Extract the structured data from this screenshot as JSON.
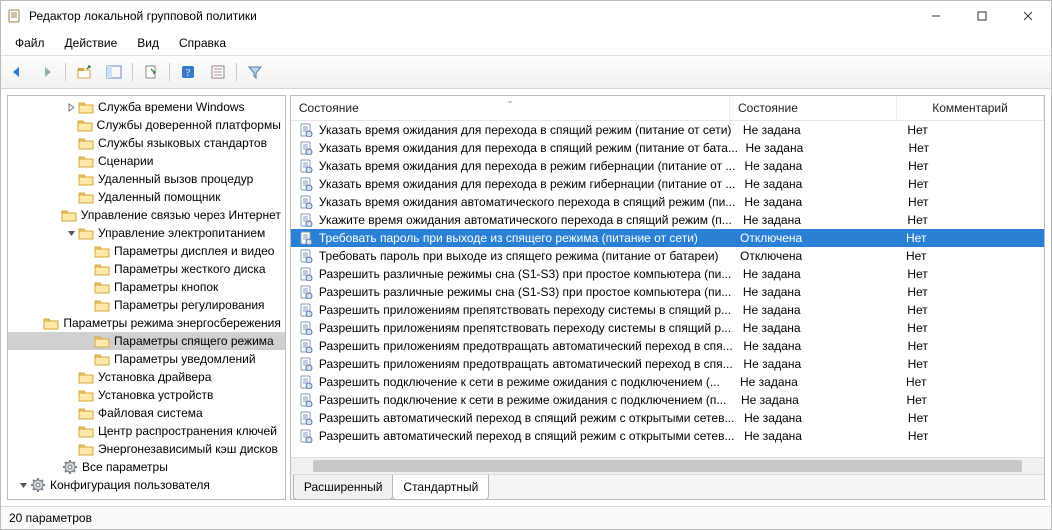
{
  "title": "Редактор локальной групповой политики",
  "menu": [
    "Файл",
    "Действие",
    "Вид",
    "Справка"
  ],
  "columns": {
    "name": "Состояние",
    "state": "Состояние",
    "comment": "Комментарий"
  },
  "tabs": {
    "extended": "Расширенный",
    "standard": "Стандартный"
  },
  "status": "20 параметров",
  "tree": [
    {
      "depth": 3,
      "expand": "closed",
      "icon": "folder",
      "label": "Служба времени Windows"
    },
    {
      "depth": 3,
      "expand": "none",
      "icon": "folder",
      "label": "Службы доверенной платформы"
    },
    {
      "depth": 3,
      "expand": "none",
      "icon": "folder",
      "label": "Службы языковых стандартов"
    },
    {
      "depth": 3,
      "expand": "none",
      "icon": "folder",
      "label": "Сценарии"
    },
    {
      "depth": 3,
      "expand": "none",
      "icon": "folder",
      "label": "Удаленный вызов процедур"
    },
    {
      "depth": 3,
      "expand": "none",
      "icon": "folder",
      "label": "Удаленный помощник"
    },
    {
      "depth": 3,
      "expand": "none",
      "icon": "folder",
      "label": "Управление связью через Интернет"
    },
    {
      "depth": 3,
      "expand": "open",
      "icon": "folder",
      "label": "Управление электропитанием"
    },
    {
      "depth": 4,
      "expand": "none",
      "icon": "folder",
      "label": "Параметры дисплея и видео"
    },
    {
      "depth": 4,
      "expand": "none",
      "icon": "folder",
      "label": "Параметры жесткого диска"
    },
    {
      "depth": 4,
      "expand": "none",
      "icon": "folder",
      "label": "Параметры кнопок"
    },
    {
      "depth": 4,
      "expand": "none",
      "icon": "folder",
      "label": "Параметры регулирования"
    },
    {
      "depth": 4,
      "expand": "none",
      "icon": "folder",
      "label": "Параметры режима энергосбережения"
    },
    {
      "depth": 4,
      "expand": "none",
      "icon": "folder",
      "label": "Параметры спящего режима",
      "selected": true
    },
    {
      "depth": 4,
      "expand": "none",
      "icon": "folder",
      "label": "Параметры уведомлений"
    },
    {
      "depth": 3,
      "expand": "none",
      "icon": "folder",
      "label": "Установка драйвера"
    },
    {
      "depth": 3,
      "expand": "none",
      "icon": "folder",
      "label": "Установка устройств"
    },
    {
      "depth": 3,
      "expand": "none",
      "icon": "folder",
      "label": "Файловая система"
    },
    {
      "depth": 3,
      "expand": "none",
      "icon": "folder",
      "label": "Центр распространения ключей"
    },
    {
      "depth": 3,
      "expand": "none",
      "icon": "folder",
      "label": "Энергонезависимый кэш дисков"
    },
    {
      "depth": 2,
      "expand": "none",
      "icon": "gear",
      "label": "Все параметры"
    },
    {
      "depth": 0,
      "expand": "open",
      "icon": "gear",
      "label": "Конфигурация пользователя"
    }
  ],
  "list": [
    {
      "name": "Указать время ожидания для перехода в спящий режим (питание от сети)",
      "state": "Не задана",
      "comment": "Нет"
    },
    {
      "name": "Указать время ожидания для перехода в спящий режим (питание от бата...",
      "state": "Не задана",
      "comment": "Нет"
    },
    {
      "name": "Указать время ожидания для перехода в режим гибернации (питание от ...",
      "state": "Не задана",
      "comment": "Нет"
    },
    {
      "name": "Указать время ожидания для перехода в режим гибернации (питание от ...",
      "state": "Не задана",
      "comment": "Нет"
    },
    {
      "name": "Указать время ожидания автоматического перехода в спящий режим (пи...",
      "state": "Не задана",
      "comment": "Нет"
    },
    {
      "name": "Укажите время ожидания автоматического перехода в спящий режим (п...",
      "state": "Не задана",
      "comment": "Нет"
    },
    {
      "name": "Требовать пароль при выходе из спящего режима (питание от сети)",
      "state": "Отключена",
      "comment": "Нет",
      "selected": true
    },
    {
      "name": "Требовать пароль при выходе из спящего режима (питание от батареи)",
      "state": "Отключена",
      "comment": "Нет"
    },
    {
      "name": "Разрешить различные режимы сна (S1-S3) при простое компьютера (пи...",
      "state": "Не задана",
      "comment": "Нет"
    },
    {
      "name": "Разрешить различные режимы сна (S1-S3) при простое компьютера (пи...",
      "state": "Не задана",
      "comment": "Нет"
    },
    {
      "name": "Разрешить приложениям препятствовать переходу системы в спящий р...",
      "state": "Не задана",
      "comment": "Нет"
    },
    {
      "name": "Разрешить приложениям препятствовать переходу системы в спящий р...",
      "state": "Не задана",
      "comment": "Нет"
    },
    {
      "name": "Разрешить приложениям предотвращать автоматический переход в спя...",
      "state": "Не задана",
      "comment": "Нет"
    },
    {
      "name": "Разрешить приложениям предотвращать автоматический переход в спя...",
      "state": "Не задана",
      "comment": "Нет"
    },
    {
      "name": "Разрешить подключение к сети в режиме ожидания с подключением (...",
      "state": "Не задана",
      "comment": "Нет"
    },
    {
      "name": "Разрешить подключение к сети в режиме ожидания с подключением (п...",
      "state": "Не задана",
      "comment": "Нет"
    },
    {
      "name": "Разрешить автоматический переход в спящий режим с открытыми сетев...",
      "state": "Не задана",
      "comment": "Нет"
    },
    {
      "name": "Разрешить автоматический переход в спящий режим с открытыми сетев...",
      "state": "Не задана",
      "comment": "Нет"
    }
  ]
}
